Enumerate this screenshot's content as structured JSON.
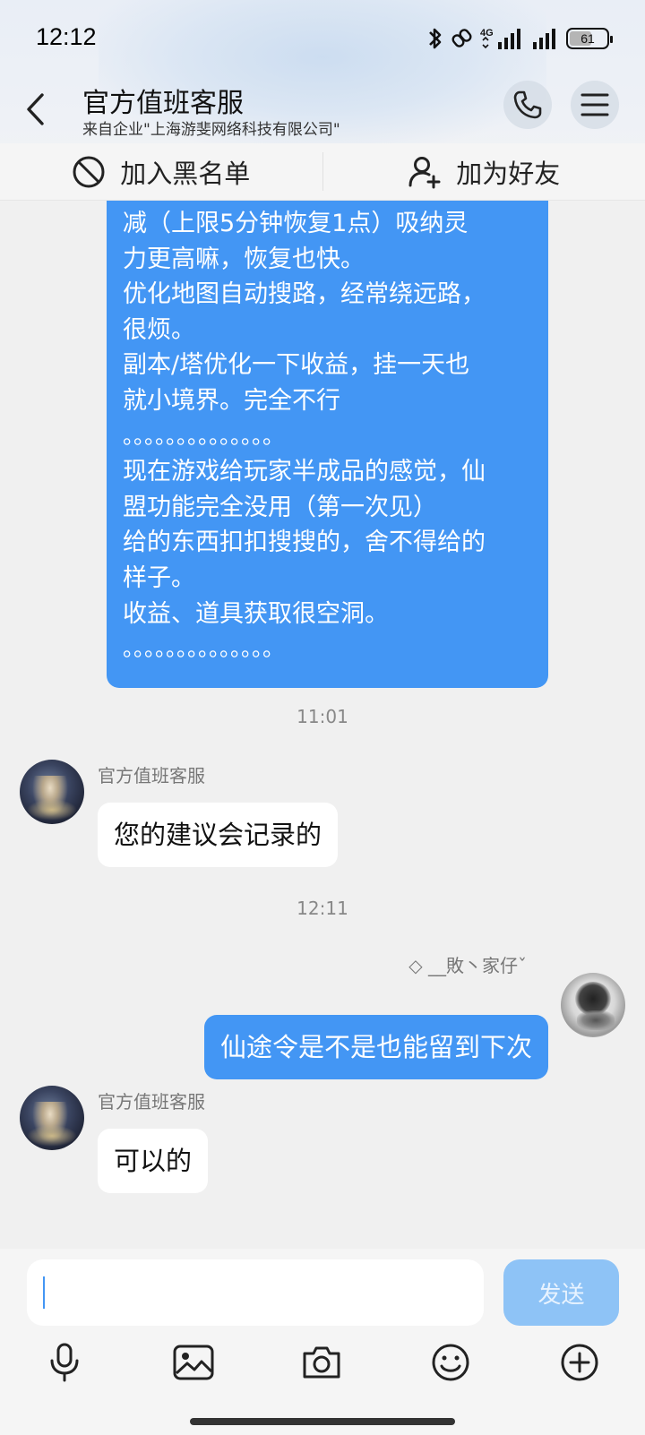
{
  "status_bar": {
    "time": "12:12",
    "network": "4G",
    "battery": "61",
    "battery_level": 0.61
  },
  "header": {
    "title": "官方值班客服",
    "subtitle": "来自企业\"上海游斐网络科技有限公司\""
  },
  "actions": {
    "blacklist": "加入黑名单",
    "add_friend": "加为好友"
  },
  "messages": {
    "big_bubble_lines": [
      "减（上限5分钟恢复1点）吸纳灵",
      "力更高嘛，恢复也快。",
      "优化地图自动搜路，经常绕远路，",
      "很烦。",
      "副本/塔优化一下收益，挂一天也",
      "就小境界。完全不行",
      "。。。。。。。。。。。。。。",
      "现在游戏给玩家半成品的感觉，仙",
      "盟功能完全没用（第一次见）",
      "给的东西扣扣搜搜的，舍不得给的",
      "样子。",
      "收益、道具获取很空洞。",
      "。。。。。。。。。。。。。。"
    ],
    "time1": "11:01",
    "cs_name_1": "官方值班客服",
    "reply1": "您的建议会记录的",
    "time2": "12:11",
    "my_name": "◇ __敗丶家仔ˇ",
    "my_msg": "仙途令是不是也能留到下次",
    "cs_name_2": "官方值班客服",
    "reply2": "可以的"
  },
  "input": {
    "value": "",
    "send_label": "发送"
  },
  "icons": {
    "back": "chevron-left-icon",
    "call": "phone-icon",
    "menu": "menu-icon",
    "blacklist": "block-icon",
    "add_friend": "add-user-icon",
    "voice": "microphone-icon",
    "image": "image-icon",
    "camera": "camera-icon",
    "emoji": "emoji-icon",
    "more": "plus-circle-icon"
  },
  "colors": {
    "bubble_out": "#4396f4",
    "send_disabled": "#8ec3f6",
    "background": "#f0f0f0"
  }
}
